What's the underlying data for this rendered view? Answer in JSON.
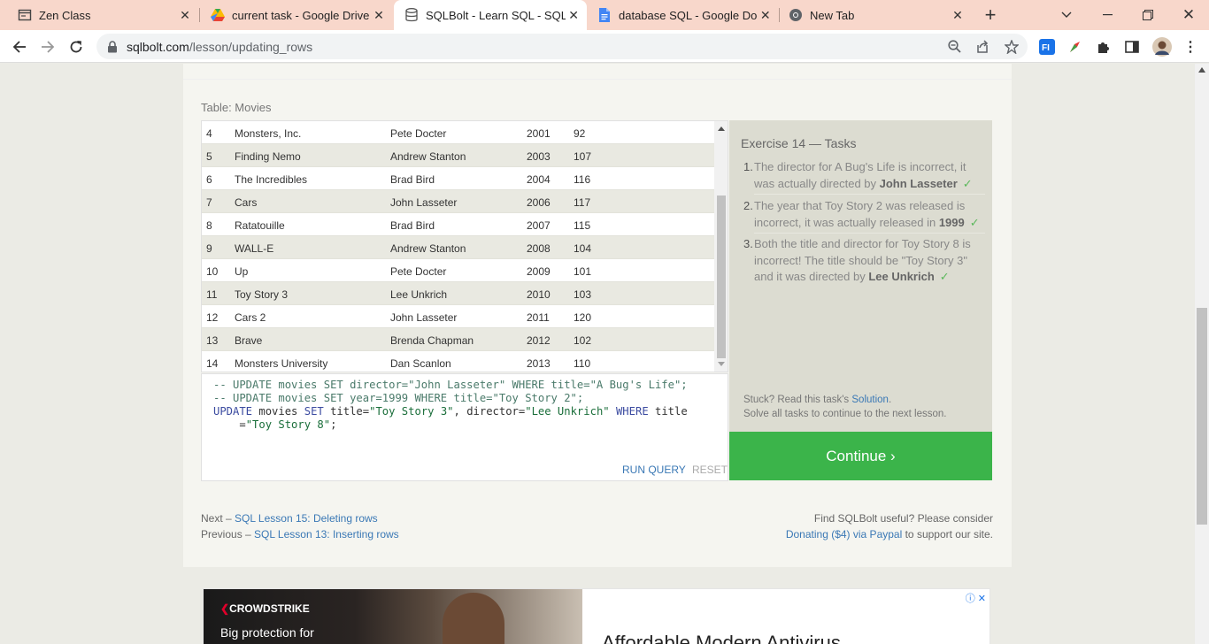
{
  "browser": {
    "tabs": [
      {
        "title": "Zen Class",
        "icon": "window-icon"
      },
      {
        "title": "current task - Google Drive",
        "icon": "drive-icon"
      },
      {
        "title": "SQLBolt - Learn SQL - SQL Le",
        "icon": "database-icon"
      },
      {
        "title": "database SQL - Google Docs",
        "icon": "docs-icon"
      },
      {
        "title": "New Tab",
        "icon": "chrome-icon"
      }
    ],
    "new_tab": "+",
    "url_host": "sqlbolt.com",
    "url_path": "/lesson/updating_rows"
  },
  "lesson": {
    "table_label": "Table: Movies",
    "rows": [
      {
        "id": "4",
        "title": "Monsters, Inc.",
        "director": "Pete Docter",
        "year": "2001",
        "length": "92"
      },
      {
        "id": "5",
        "title": "Finding Nemo",
        "director": "Andrew Stanton",
        "year": "2003",
        "length": "107"
      },
      {
        "id": "6",
        "title": "The Incredibles",
        "director": "Brad Bird",
        "year": "2004",
        "length": "116"
      },
      {
        "id": "7",
        "title": "Cars",
        "director": "John Lasseter",
        "year": "2006",
        "length": "117"
      },
      {
        "id": "8",
        "title": "Ratatouille",
        "director": "Brad Bird",
        "year": "2007",
        "length": "115"
      },
      {
        "id": "9",
        "title": "WALL-E",
        "director": "Andrew Stanton",
        "year": "2008",
        "length": "104"
      },
      {
        "id": "10",
        "title": "Up",
        "director": "Pete Docter",
        "year": "2009",
        "length": "101"
      },
      {
        "id": "11",
        "title": "Toy Story 3",
        "director": "Lee Unkrich",
        "year": "2010",
        "length": "103"
      },
      {
        "id": "12",
        "title": "Cars 2",
        "director": "John Lasseter",
        "year": "2011",
        "length": "120"
      },
      {
        "id": "13",
        "title": "Brave",
        "director": "Brenda Chapman",
        "year": "2012",
        "length": "102"
      },
      {
        "id": "14",
        "title": "Monsters University",
        "director": "Dan Scanlon",
        "year": "2013",
        "length": "110"
      }
    ],
    "code": {
      "line1": "-- UPDATE movies SET director=\"John Lasseter\" WHERE title=\"A Bug's Life\";",
      "line2": "-- UPDATE movies SET year=1999 WHERE title=\"Toy Story 2\";",
      "line3_kw1": "UPDATE",
      "line3_a": " movies ",
      "line3_kw2": "SET",
      "line3_b": " title=",
      "line3_s1": "\"Toy Story 3\"",
      "line3_c": ", director=",
      "line3_s2": "\"Lee Unkrich\"",
      "line3_d": " ",
      "line3_kw3": "WHERE",
      "line3_e": " title",
      "line4_a": "    =",
      "line4_s": "\"Toy Story 8\"",
      "line4_b": ";"
    },
    "run_label": "RUN QUERY",
    "reset_label": "RESET"
  },
  "tasks": {
    "header": "Exercise 14 — Tasks",
    "items": [
      {
        "num": "1.",
        "text": "The director for A Bug's Life is incorrect, it was actually directed by ",
        "bold": "John Lasseter",
        "check": "✓"
      },
      {
        "num": "2.",
        "text": "The year that Toy Story 2 was released is incorrect, it was actually released in ",
        "bold": "1999",
        "check": "✓"
      },
      {
        "num": "3.",
        "text": "Both the title and director for Toy Story 8 is incorrect! The title should be \"Toy Story 3\" and it was directed by ",
        "bold": "Lee Unkrich",
        "check": "✓"
      }
    ],
    "stuck_prefix": "Stuck? Read this task's ",
    "solution_link": "Solution",
    "stuck_suffix": ".",
    "solve_all": "Solve all tasks to continue to the next lesson.",
    "continue_label": "Continue ›"
  },
  "footer": {
    "next_prefix": "Next – ",
    "next_link": "SQL Lesson 15: Deleting rows",
    "prev_prefix": "Previous – ",
    "prev_link": "SQL Lesson 13: Inserting rows",
    "useful": "Find SQLBolt useful? Please consider",
    "donate_link": "Donating ($4) via Paypal",
    "donate_suffix": " to support our site."
  },
  "ad": {
    "brand": "CROWDSTRIKE",
    "sub": "Big protection for",
    "headline": "Affordable Modern Antivirus"
  },
  "colors": {
    "continue": "#3bb44a",
    "link": "#3a78b5",
    "tab_bar": "#f8d7cb"
  }
}
